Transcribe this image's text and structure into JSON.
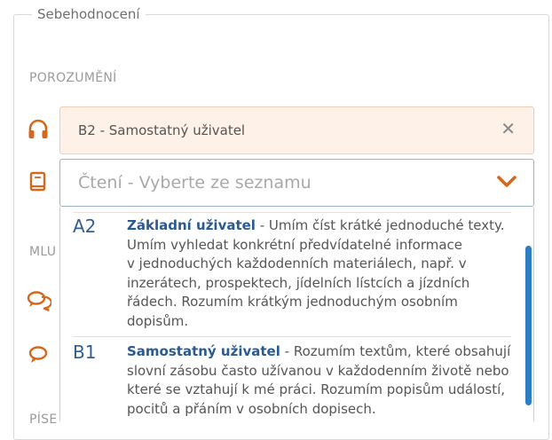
{
  "fieldset": {
    "legend": "Sebehodnocení"
  },
  "sections": {
    "porozumeni": "POROZUMĚNÍ",
    "mluveni_partial": "MLU",
    "psani_partial": "PÍSE"
  },
  "listening": {
    "icon": "headphones-icon",
    "selected_value": "B2 - Samostatný uživatel",
    "clear_symbol": "✕"
  },
  "reading": {
    "icon": "book-icon",
    "placeholder": "Čtení - Vyberte ze seznamu"
  },
  "speaking_icons": [
    "chat-bubbles-icon",
    "chat-bubble-icon"
  ],
  "colors": {
    "accent": "#d2691e",
    "link_blue": "#2a5a92",
    "scroll": "#2f7dc1"
  },
  "options": [
    {
      "code": "A2",
      "title": "Základní uživatel",
      "lines": [
        " - Umím číst krátké jednoduché texty.",
        "Umím vyhledat konkrétní předvídatelné informace",
        "v jednoduchých každodenních materiálech, např. v",
        "inzerátech, prospektech, jídelních lístcích a jízdních",
        "řádech. Rozumím krátkým jednoduchým osobním",
        "dopisům."
      ]
    },
    {
      "code": "B1",
      "title": "Samostatný uživatel",
      "lines": [
        " - Rozumím textům, které obsahují",
        "slovní zásobu často užívanou v každodenním životě nebo",
        "které se vztahují k mé práci. Rozumím popisům událostí,",
        "pocitů a přáním v osobních dopisech."
      ]
    }
  ]
}
